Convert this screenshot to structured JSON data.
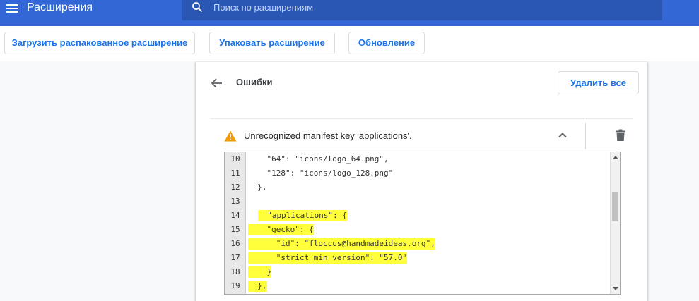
{
  "header": {
    "title": "Расширения",
    "search_placeholder": "Поиск по расширениям"
  },
  "toolbar": {
    "load_unpacked": "Загрузить распакованное расширение",
    "pack": "Упаковать расширение",
    "update": "Обновление"
  },
  "errors": {
    "title": "Ошибки",
    "delete_all": "Удалить все",
    "message": "Unrecognized manifest key 'applications'."
  },
  "code": {
    "lines": [
      {
        "num": "10",
        "text": "    \"64\": \"icons/logo_64.png\","
      },
      {
        "num": "11",
        "text": "    \"128\": \"icons/logo_128.png\""
      },
      {
        "num": "12",
        "text": "  },"
      },
      {
        "num": "13",
        "text": ""
      },
      {
        "num": "14",
        "text": "  \"applications\": {"
      },
      {
        "num": "15",
        "text": "    \"gecko\": {"
      },
      {
        "num": "16",
        "text": "      \"id\": \"floccus@handmadeideas.org\","
      },
      {
        "num": "17",
        "text": "      \"strict_min_version\": \"57.0\""
      },
      {
        "num": "18",
        "text": "    }"
      },
      {
        "num": "19",
        "text": "  },"
      }
    ]
  },
  "colors": {
    "header": "#3367d6",
    "accent": "#1a73e8",
    "warning": "#f29900",
    "highlight": "#ffff3b"
  },
  "icons": {
    "menu": "menu-icon",
    "search": "search-icon",
    "back": "arrow-back-icon",
    "warning": "warning-icon",
    "collapse": "chevron-up-icon",
    "delete": "trash-icon"
  }
}
